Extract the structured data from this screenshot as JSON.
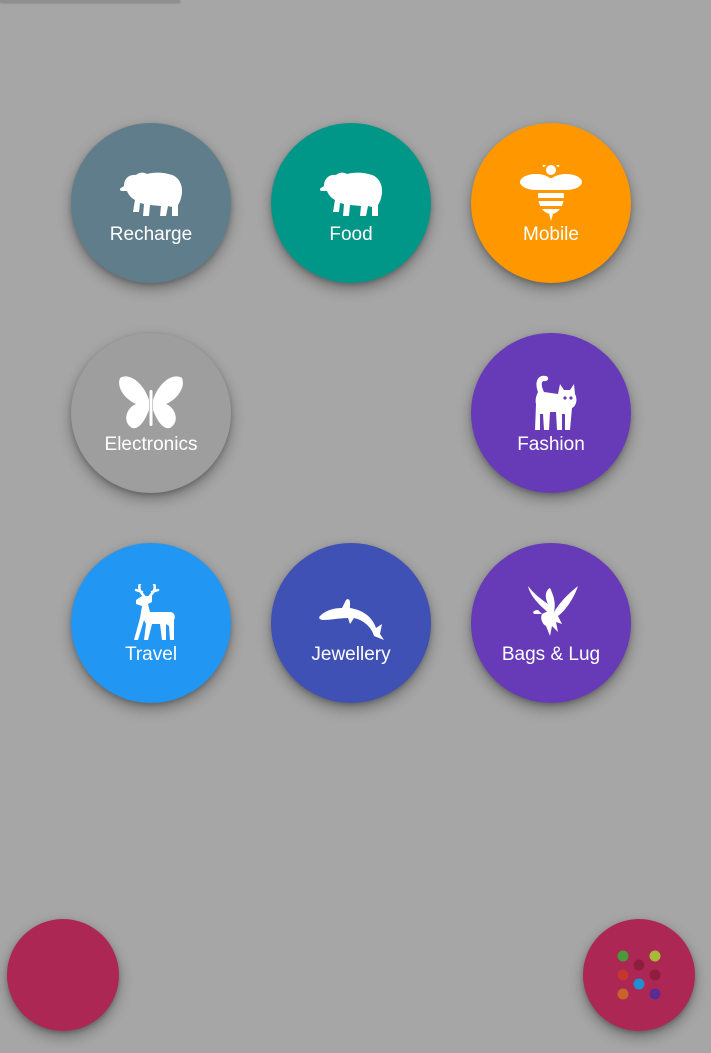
{
  "menu": {
    "items": [
      {
        "label": "Recharge",
        "icon": "polar-bear-icon",
        "color": "#607D8B"
      },
      {
        "label": "Food",
        "icon": "polar-bear-icon",
        "color": "#009688"
      },
      {
        "label": "Mobile",
        "icon": "bee-icon",
        "color": "#FF9800"
      },
      {
        "label": "Electronics",
        "icon": "butterfly-icon",
        "color": "#9E9E9E"
      },
      {
        "label": "Fashion",
        "icon": "cat-icon",
        "color": "#673AB7"
      },
      {
        "label": "Travel",
        "icon": "deer-icon",
        "color": "#2196F3"
      },
      {
        "label": "Jewellery",
        "icon": "dolphin-icon",
        "color": "#3F51B5"
      },
      {
        "label": "Bags & Lug",
        "icon": "eagle-icon",
        "color": "#673AB7"
      }
    ]
  },
  "fabs": {
    "left": {
      "icon": "",
      "color": "#AD2754"
    },
    "right": {
      "icon": "dots-grid-icon",
      "color": "#AD2754"
    }
  }
}
